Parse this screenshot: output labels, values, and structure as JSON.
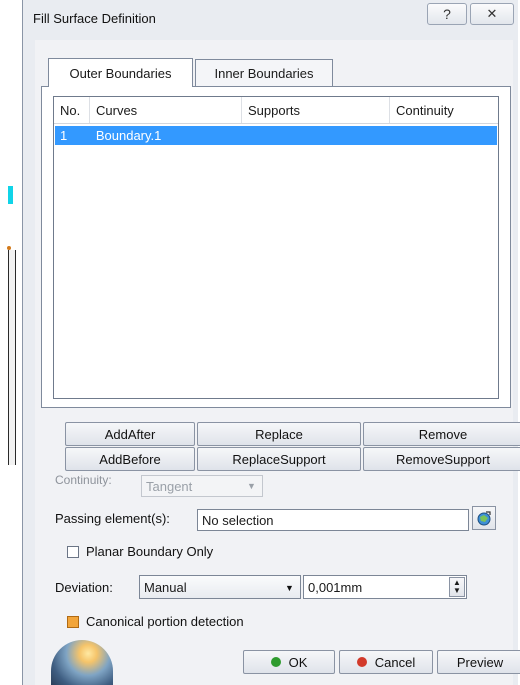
{
  "window": {
    "title": "Fill Surface Definition",
    "help_glyph": "?",
    "close_glyph": "✕"
  },
  "tabs": [
    {
      "label": "Outer Boundaries",
      "active": true
    },
    {
      "label": "Inner Boundaries",
      "active": false
    }
  ],
  "boundary_list": {
    "columns": [
      "No.",
      "Curves",
      "Supports",
      "Continuity"
    ],
    "rows": [
      {
        "no": "1",
        "curves": "Boundary.1",
        "supports": "",
        "continuity": "",
        "selected": true
      }
    ]
  },
  "list_buttons": {
    "add_after": "AddAfter",
    "replace": "Replace",
    "remove": "Remove",
    "add_before": "AddBefore",
    "replace_support": "ReplaceSupport",
    "remove_support": "RemoveSupport"
  },
  "continuity": {
    "label": "Continuity:",
    "value": "Tangent",
    "enabled": false
  },
  "passing_elements": {
    "label": "Passing element(s):",
    "value": "No selection"
  },
  "planar_boundary": {
    "label": "Planar Boundary Only",
    "checked": false
  },
  "deviation": {
    "label": "Deviation:",
    "mode": "Manual",
    "value": "0,001mm"
  },
  "canonical": {
    "label": "Canonical portion detection",
    "checked": true
  },
  "actions": {
    "ok": "OK",
    "cancel": "Cancel",
    "preview": "Preview"
  },
  "colors": {
    "selection": "#3399ff",
    "ok_dot": "#2e9b2e",
    "cancel_dot": "#d23a2a",
    "checkbox_checked": "#f2a53a"
  }
}
